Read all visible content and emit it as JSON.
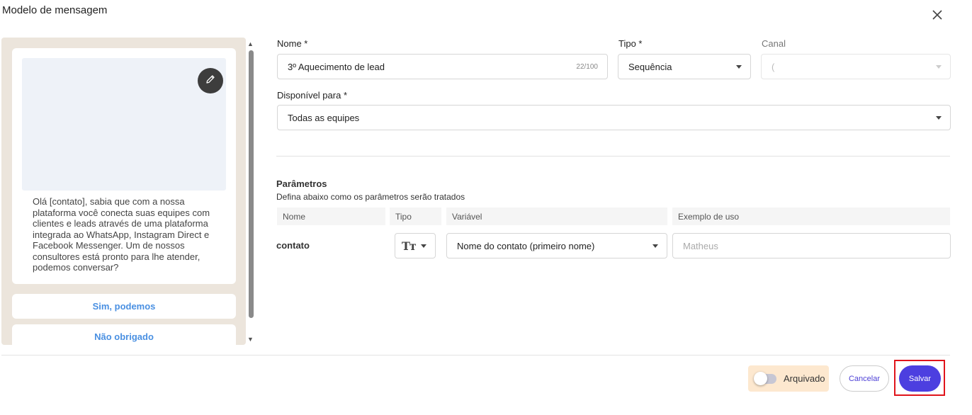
{
  "dialog": {
    "title": "Modelo de mensagem"
  },
  "icons": {
    "close": "close-icon",
    "edit": "pencil-icon",
    "text_type": "text-type-icon"
  },
  "preview": {
    "message": "Olá [contato], sabia que com a nossa plataforma você conecta suas equipes com clientes e leads através de uma plataforma integrada ao WhatsApp, Instagram Direct e Facebook Messenger. Um de nossos consultores está pronto para lhe atender, podemos conversar?",
    "buttons": [
      "Sim, podemos",
      "Não obrigado"
    ]
  },
  "form": {
    "name_label": "Nome *",
    "name_value": "3º Aquecimento de lead",
    "name_counter": "22/100",
    "type_label": "Tipo *",
    "type_value": "Sequência",
    "channel_label": "Canal",
    "channel_value": "(",
    "available_label": "Disponível para *",
    "available_value": "Todas as equipes"
  },
  "parameters": {
    "title": "Parâmetros",
    "description": "Defina abaixo como os parâmetros serão tratados",
    "headers": [
      "Nome",
      "Tipo",
      "Variável",
      "Exemplo de uso"
    ],
    "rows": [
      {
        "name": "contato",
        "type_icon": "Tт",
        "variable": "Nome do contato (primeiro nome)",
        "example_placeholder": "Matheus"
      }
    ]
  },
  "footer": {
    "archived_label": "Arquivado",
    "archived_on": false,
    "cancel_label": "Cancelar",
    "save_label": "Salvar"
  },
  "colors": {
    "primary": "#4c3fe0",
    "highlight": "#e0141b",
    "archived_bg": "#fde8cf",
    "link": "#4a90e2"
  }
}
